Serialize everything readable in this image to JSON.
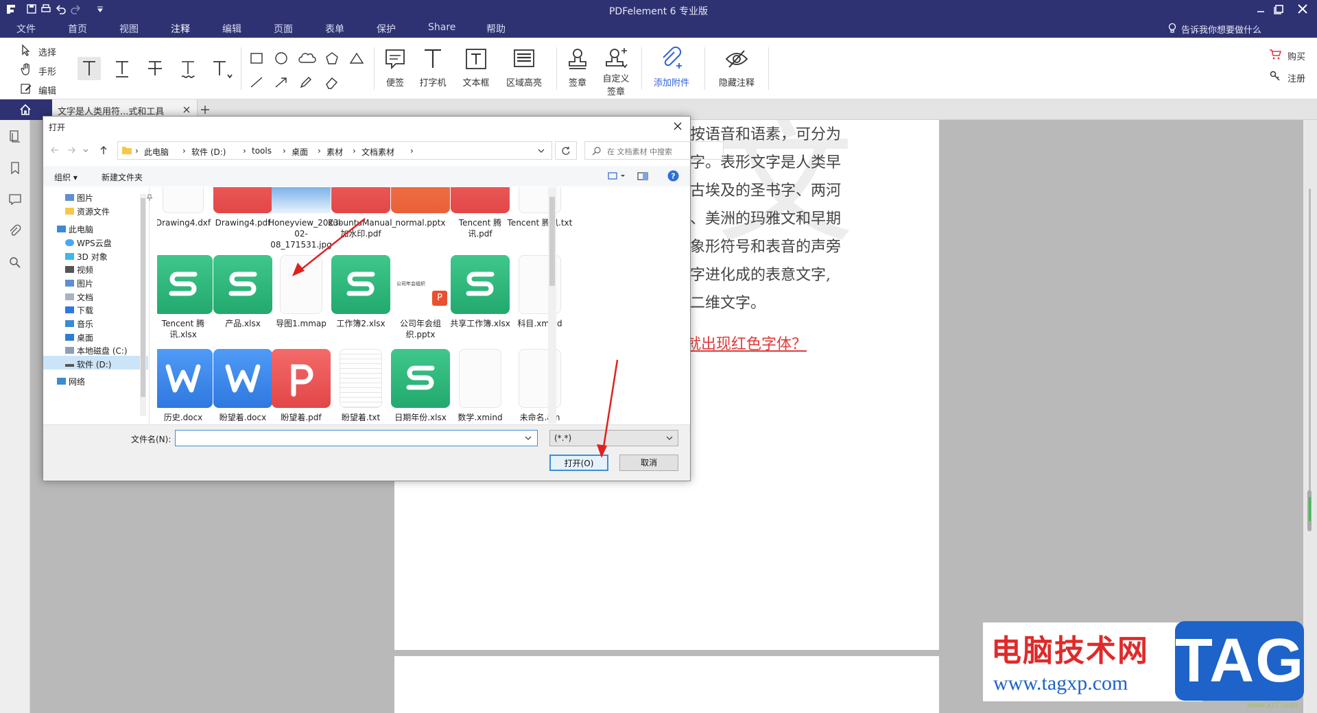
{
  "app": {
    "title": "PDFelement  6 专业版",
    "menus": [
      "文件",
      "首页",
      "视图",
      "注释",
      "编辑",
      "页面",
      "表单",
      "保护",
      "Share",
      "帮助"
    ],
    "active_menu": "注释",
    "tell_me": "告诉我你想要做什么"
  },
  "ribbon": {
    "select": "选择",
    "hand": "手形",
    "edit": "编辑",
    "note": "便签",
    "typewriter": "打字机",
    "textbox": "文本框",
    "area_highlight": "区域高亮",
    "stamp": "签章",
    "custom_stamp_line1": "自定义",
    "custom_stamp_line2": "签章",
    "add_attachment": "添加附件",
    "hide_annot": "隐藏注释",
    "buy": "购买",
    "register": "注册"
  },
  "tab": {
    "doc_title": "文字是人类用符...式和工具"
  },
  "document": {
    "lines": [
      "按语音和语素，可分为",
      "字。表形文字是人类早",
      "古埃及的圣书字、两河",
      "、美洲的玛雅文和早期",
      "象形符号和表音的声旁",
      "字进化成的表意文字,",
      "二维文字。"
    ],
    "red_link": "就出现红色字体？"
  },
  "dialog": {
    "title": "打开",
    "breadcrumbs": [
      "此电脑",
      "软件 (D:)",
      "tools",
      "桌面",
      "素材",
      "文档素材"
    ],
    "search_placeholder": "在 文档素材 中搜索",
    "organize": "组织",
    "new_folder": "新建文件夹",
    "nav": [
      "图片",
      "资源文件",
      "此电脑",
      "WPS云盘",
      "3D 对象",
      "视频",
      "图片",
      "文档",
      "下载",
      "音乐",
      "桌面",
      "本地磁盘 (C:)",
      "软件 (D:)",
      "网络"
    ],
    "files_row1": [
      "Drawing4.dxf",
      "Drawing4.pdf",
      "Honeyview_2023-02-08_171531.jpg",
      "KubuntuManual_加水印.pdf",
      "normal.pptx",
      "Tencent 腾讯.pdf",
      "Tencent 腾讯.txt"
    ],
    "files_row2": [
      "Tencent 腾讯.xlsx",
      "产品.xlsx",
      "导图1.mmap",
      "工作簿2.xlsx",
      "公司年会组织.pptx",
      "共享工作簿.xlsx",
      "科目.xmind"
    ],
    "files_row3": [
      "历史.docx",
      "盼望着.docx",
      "盼望着.pdf",
      "盼望着.txt",
      "日期年份.xlsx",
      "数学.xmind",
      "未命名.am"
    ],
    "pptx_thumb_text": "公司年会组织",
    "filename_label": "文件名(N):",
    "filename_value": "",
    "filter": "(*.*)",
    "open_btn": "打开(O)",
    "cancel_btn": "取消"
  },
  "watermark": {
    "site_name": "电脑技术网",
    "url": "www.tagxp.com",
    "tag": "TAG",
    "small": "www.xz7.com"
  },
  "colors": {
    "titlebar": "#2e3273",
    "accent": "#2e3273",
    "red": "#e03a3a",
    "wps_green": "#2fb57a",
    "wps_blue": "#3d86ec",
    "wps_red": "#ea5252",
    "tag_blue": "#1d63c9"
  }
}
